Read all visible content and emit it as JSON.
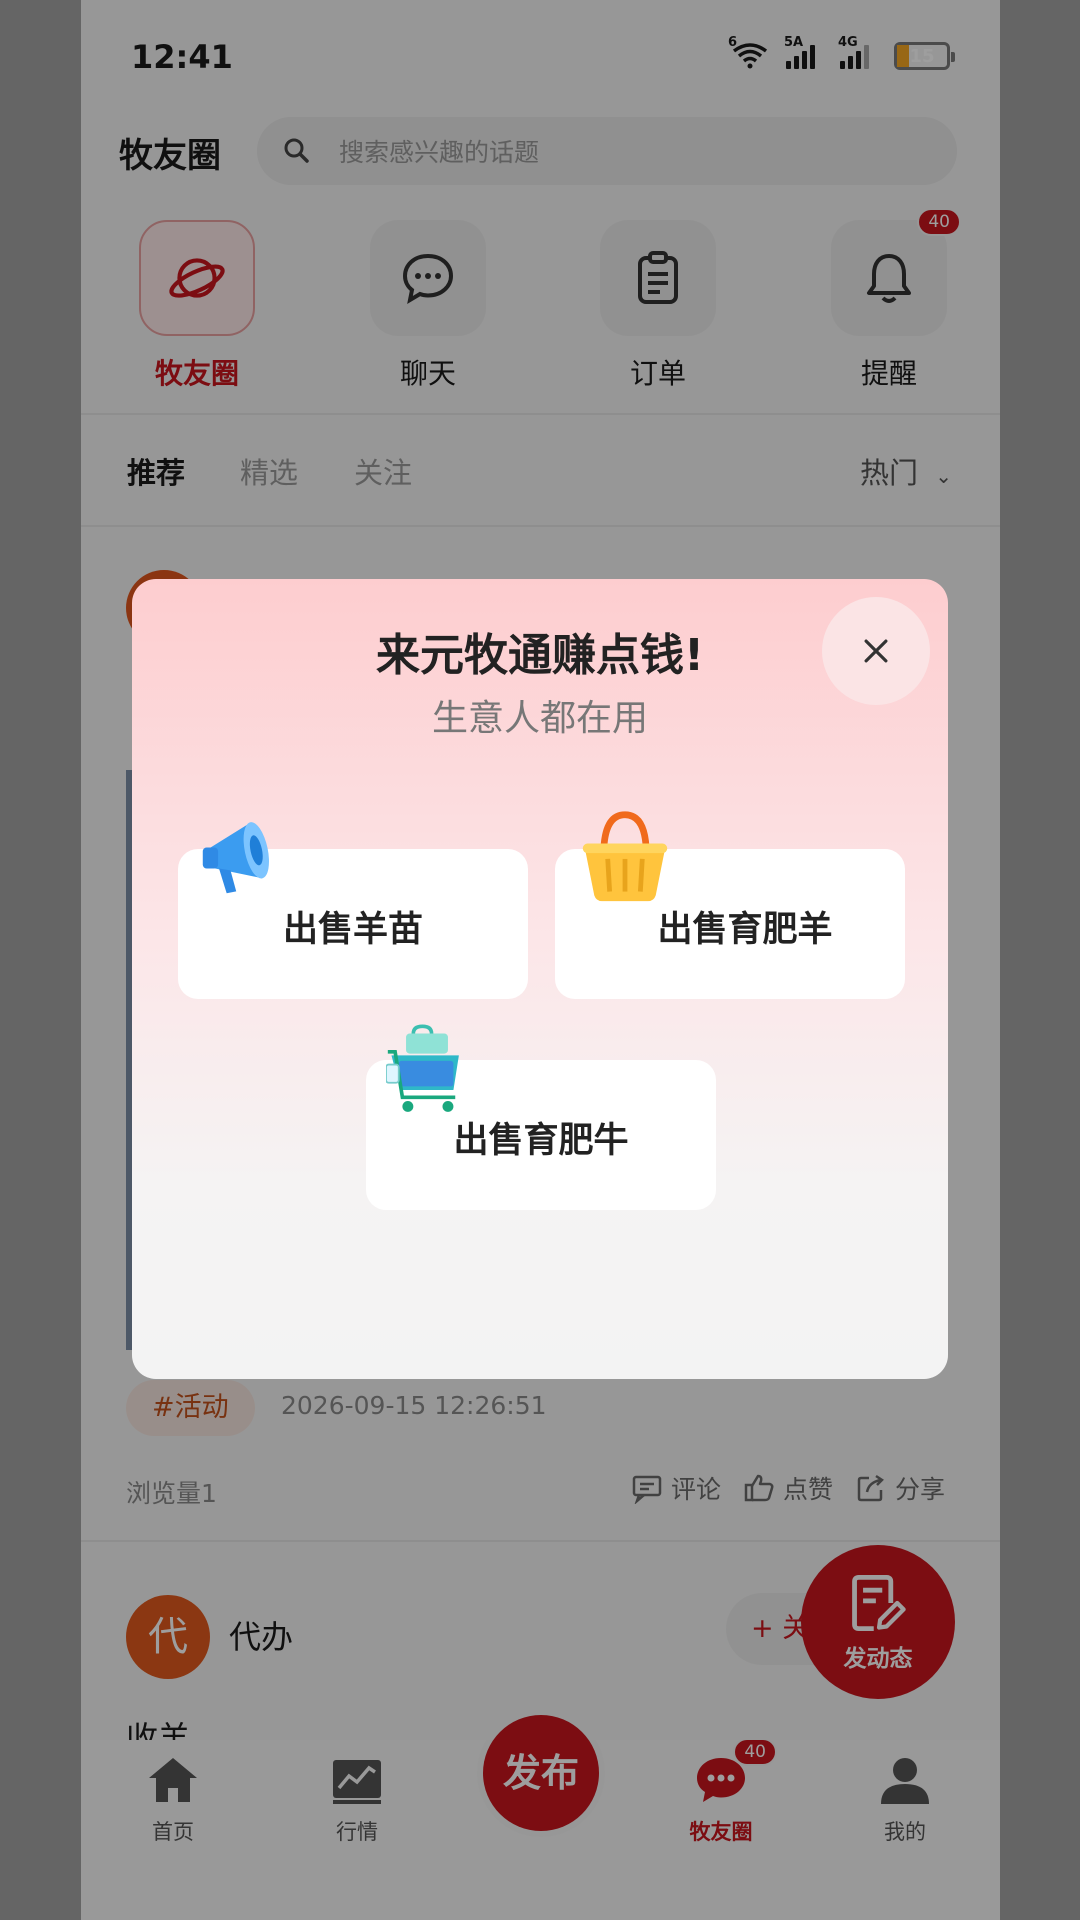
{
  "status_bar": {
    "time": "12:41",
    "wifi_tag": "6",
    "sim1_tag": "5A",
    "sim2_tag": "4G",
    "battery": "15"
  },
  "header": {
    "title": "牧友圈",
    "search_placeholder": "搜索感兴趣的话题"
  },
  "quick_nav": [
    {
      "label": "牧友圈",
      "icon": "planet-icon",
      "active": true
    },
    {
      "label": "聊天",
      "icon": "chat-bubble-icon"
    },
    {
      "label": "订单",
      "icon": "clipboard-icon"
    },
    {
      "label": "提醒",
      "icon": "bell-icon",
      "badge": "40"
    }
  ],
  "tabs": [
    "推荐",
    "精选",
    "关注"
  ],
  "sort": {
    "label": "热门",
    "icon": "chevron-down-icon"
  },
  "post1": {
    "tag": "#活动",
    "time": "2026-09-15 12:26:51",
    "views": "浏览量1"
  },
  "actions": [
    {
      "label": "评论",
      "icon": "comment-icon"
    },
    {
      "label": "点赞",
      "icon": "thumbs-up-icon"
    },
    {
      "label": "分享",
      "icon": "share-icon"
    }
  ],
  "post2": {
    "avatar_char": "代",
    "name": "代办",
    "follow_label": "+ 关",
    "text": "收羊"
  },
  "fab": {
    "label": "发动态",
    "icon": "edit-note-icon"
  },
  "bottom_nav": [
    {
      "label": "首页",
      "icon": "home-icon"
    },
    {
      "label": "行情",
      "icon": "trend-chart-icon"
    },
    {
      "label": "牧友圈",
      "icon": "chat-dots-icon",
      "badge": "40",
      "active": true
    },
    {
      "label": "我的",
      "icon": "person-icon"
    }
  ],
  "publish_label": "发布",
  "modal": {
    "title": "来元牧通赚点钱!",
    "subtitle": "生意人都在用",
    "options": [
      {
        "label": "出售羊苗",
        "icon": "megaphone-icon"
      },
      {
        "label": "出售育肥羊",
        "icon": "basket-icon"
      },
      {
        "label": "出售育肥牛",
        "icon": "shopping-cart-icon"
      }
    ]
  },
  "colors": {
    "accent": "#c8161d",
    "modal_top": "#fdcdcf"
  }
}
